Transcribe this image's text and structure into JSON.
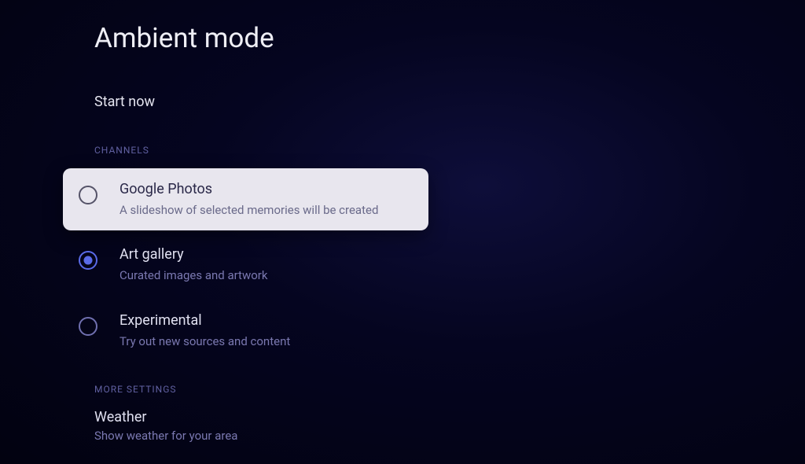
{
  "page": {
    "title": "Ambient mode"
  },
  "actions": {
    "start_now": "Start now"
  },
  "sections": {
    "channels_header": "CHANNELS",
    "more_settings_header": "MORE SETTINGS"
  },
  "channels": [
    {
      "title": "Google Photos",
      "description": "A slideshow of selected memories will be created",
      "focused": true,
      "selected": false
    },
    {
      "title": "Art gallery",
      "description": "Curated images and artwork",
      "focused": false,
      "selected": true
    },
    {
      "title": "Experimental",
      "description": "Try out new sources and content",
      "focused": false,
      "selected": false
    }
  ],
  "more_settings": [
    {
      "title": "Weather",
      "description": "Show weather for your area"
    }
  ]
}
